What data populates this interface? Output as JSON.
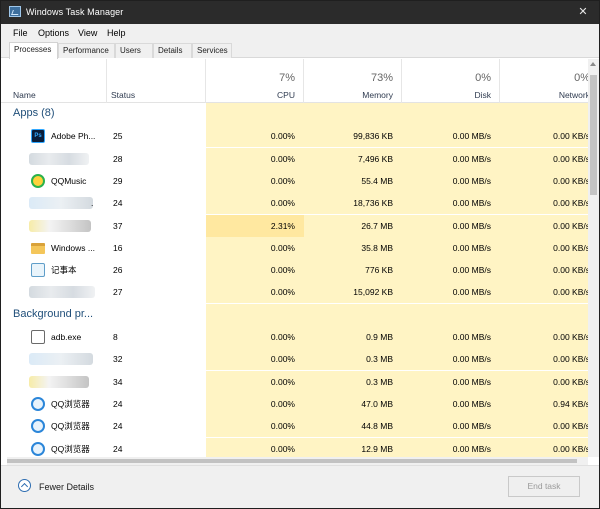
{
  "window": {
    "title": "Windows Task Manager"
  },
  "menu": [
    "File",
    "Options",
    "View",
    "Help"
  ],
  "tabs": [
    "Processes",
    "Performance",
    "Users",
    "Details",
    "Services"
  ],
  "columns": {
    "name": "Name",
    "status": "Status",
    "cpu": {
      "label": "CPU",
      "pct": "7%"
    },
    "memory": {
      "label": "Memory",
      "pct": "73%"
    },
    "disk": {
      "label": "Disk",
      "pct": "0%"
    },
    "network": {
      "label": "Network",
      "pct": "0%"
    }
  },
  "groups": {
    "apps": "Apps (8)",
    "background": "Background pr..."
  },
  "apps": [
    {
      "name": "Adobe Ph...",
      "icon": "photoshop-icon",
      "status": "25",
      "cpu": "0.00%",
      "memory": "99,836 KB",
      "disk": "0.00 MB/s",
      "network": "0.00 KB/s"
    },
    {
      "name": "",
      "icon": "blurred-icon",
      "status": "28",
      "cpu": "0.00%",
      "memory": "7,496 KB",
      "disk": "0.00 MB/s",
      "network": "0.00 KB/s"
    },
    {
      "name": "QQMusic",
      "icon": "qqmusic-icon",
      "status": "29",
      "cpu": "0.00%",
      "memory": "55.4 MB",
      "disk": "0.00 MB/s",
      "network": "0.00 KB/s"
    },
    {
      "name": ".",
      "icon": "blurred-icon",
      "status": "24",
      "cpu": "0.00%",
      "memory": "18,736 KB",
      "disk": "0.00 MB/s",
      "network": "0.00 KB/s"
    },
    {
      "name": "",
      "icon": "blurred-icon",
      "status": "37",
      "cpu": "2.31%",
      "memory": "26.7 MB",
      "disk": "0.00 MB/s",
      "network": "0.00 KB/s"
    },
    {
      "name": "Windows ...",
      "icon": "folder-icon",
      "status": "16",
      "cpu": "0.00%",
      "memory": "35.8 MB",
      "disk": "0.00 MB/s",
      "network": "0.00 KB/s"
    },
    {
      "name": "记事本",
      "icon": "notepad-icon",
      "status": "26",
      "cpu": "0.00%",
      "memory": "776 KB",
      "disk": "0.00 MB/s",
      "network": "0.00 KB/s"
    },
    {
      "name": "",
      "icon": "blurred-icon",
      "status": "27",
      "cpu": "0.00%",
      "memory": "15,092 KB",
      "disk": "0.00 MB/s",
      "network": "0.00 KB/s"
    }
  ],
  "background": [
    {
      "name": "adb.exe",
      "icon": "exe-icon",
      "status": "8",
      "cpu": "0.00%",
      "memory": "0.9 MB",
      "disk": "0.00 MB/s",
      "network": "0.00 KB/s"
    },
    {
      "name": "",
      "icon": "blurred-icon",
      "status": "32",
      "cpu": "0.00%",
      "memory": "0.3 MB",
      "disk": "0.00 MB/s",
      "network": "0.00 KB/s"
    },
    {
      "name": "",
      "icon": "blurred-icon",
      "status": "34",
      "cpu": "0.00%",
      "memory": "0.3 MB",
      "disk": "0.00 MB/s",
      "network": "0.00 KB/s"
    },
    {
      "name": "QQ浏览器",
      "icon": "qqbrowser-icon",
      "status": "24",
      "cpu": "0.00%",
      "memory": "47.0 MB",
      "disk": "0.00 MB/s",
      "network": "0.94 KB/s"
    },
    {
      "name": "QQ浏览器",
      "icon": "qqbrowser-icon",
      "status": "24",
      "cpu": "0.00%",
      "memory": "44.8 MB",
      "disk": "0.00 MB/s",
      "network": "0.00 KB/s"
    },
    {
      "name": "QQ浏览器",
      "icon": "qqbrowser-icon",
      "status": "24",
      "cpu": "0.00%",
      "memory": "12.9 MB",
      "disk": "0.00 MB/s",
      "network": "0.00 KB/s"
    }
  ],
  "footer": {
    "fewer_details": "Fewer Details",
    "end_task": "End task"
  }
}
